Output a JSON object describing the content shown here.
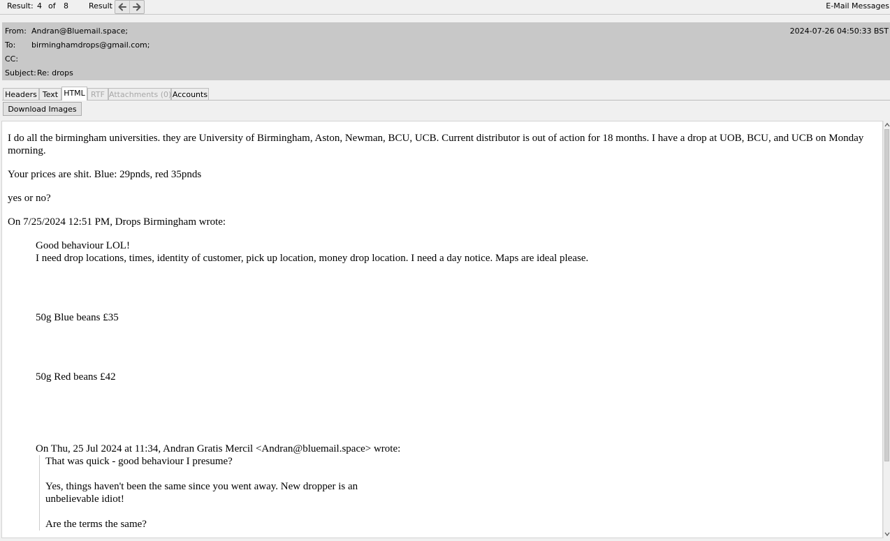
{
  "toolbar": {
    "result_label": "Result:",
    "result_current": "4",
    "result_of": "of",
    "result_total": "8",
    "result_nav_label": "Result",
    "prev_icon": "arrow-left-icon",
    "next_icon": "arrow-right-icon",
    "section_title": "E-Mail Messages"
  },
  "header": {
    "from_label": "From:",
    "from_value": "Andran@Bluemail.space;",
    "to_label": "To:",
    "to_value": "birminghamdrops@gmail.com;",
    "cc_label": "CC:",
    "cc_value": "",
    "subject_label": "Subject:",
    "subject_value": "Re: drops",
    "timestamp": "2024-07-26 04:50:33 BST"
  },
  "tabs": {
    "items": [
      "Headers",
      "Text",
      "HTML",
      "RTF",
      "Attachments (0)",
      "Accounts"
    ],
    "active": "HTML",
    "disabled": [
      "RTF",
      "Attachments (0)"
    ]
  },
  "download_images_label": "Download Images",
  "message": {
    "para1": "I do all the birmingham universities. they are University of Birmingham, Aston, Newman, BCU, UCB. Current distributor is out of action for 18 months. I have a drop at UOB, BCU, and UCB on Monday morning.",
    "para2": "Your prices are shit. Blue: 29pnds, red 35pnds",
    "para3": "yes or no?",
    "para4": "On 7/25/2024 12:51 PM, Drops Birmingham wrote:",
    "quote1": {
      "line1": "Good behaviour LOL!",
      "line2": "I need drop locations, times, identity of customer, pick up location, money drop location. I need a day notice. Maps are ideal please.",
      "line3": "50g Blue beans £35",
      "line4": "50g Red beans £42",
      "line5": "On Thu, 25 Jul 2024 at 11:34, Andran Gratis Mercil <Andran@bluemail.space> wrote:"
    },
    "quote2": {
      "line1": "That was quick - good behaviour I presume?",
      "line2": "Yes, things haven't been the same since you went away. New dropper is an unbelievable idiot!",
      "line3": "Are the terms the same?"
    }
  }
}
